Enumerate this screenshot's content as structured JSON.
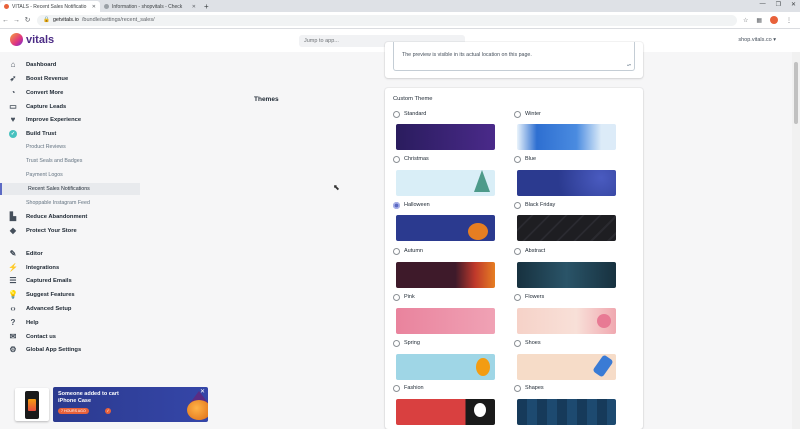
{
  "browser": {
    "tabs": [
      {
        "label": "VITALS - Recent Sales Notificatio",
        "active": true
      },
      {
        "label": "Information - shopvitals - Check",
        "active": false
      }
    ],
    "new_tab": "+",
    "url_host": "getvitals.io",
    "url_path": "/bundle/settings/recent_sales/"
  },
  "header": {
    "brand": "vitals",
    "jump_placeholder": "Jump to app...",
    "shop": "shop.vitals.co"
  },
  "sidebar": {
    "items": [
      {
        "label": "Dashboard",
        "icon": "home-icon"
      },
      {
        "label": "Boost Revenue",
        "icon": "rocket-icon"
      },
      {
        "label": "Convert More",
        "icon": "chat-icon"
      },
      {
        "label": "Capture Leads",
        "icon": "inbox-icon"
      },
      {
        "label": "Improve Experience",
        "icon": "heart-icon"
      },
      {
        "label": "Build Trust",
        "icon": "check-circle-icon"
      },
      {
        "label": "Reduce Abandonment",
        "icon": "cart-icon"
      },
      {
        "label": "Protect Your Store",
        "icon": "shield-icon"
      },
      {
        "label": "Editor",
        "icon": "pencil-icon"
      },
      {
        "label": "Integrations",
        "icon": "plug-icon"
      },
      {
        "label": "Captured Emails",
        "icon": "list-icon"
      },
      {
        "label": "Suggest Features",
        "icon": "bulb-icon"
      },
      {
        "label": "Advanced Setup",
        "icon": "code-icon"
      },
      {
        "label": "Help",
        "icon": "question-icon"
      },
      {
        "label": "Contact us",
        "icon": "mail-icon"
      },
      {
        "label": "Global App Settings",
        "icon": "gear-icon"
      }
    ],
    "sub_items": [
      {
        "label": "Product Reviews",
        "active": false
      },
      {
        "label": "Trust Seals and Badges",
        "active": false
      },
      {
        "label": "Payment Logos",
        "active": false
      },
      {
        "label": "Recent Sales Notifications",
        "active": true
      },
      {
        "label": "Shoppable Instagram Feed",
        "active": false
      }
    ]
  },
  "main": {
    "preview_text": "The preview is visible in its actual location on this page.",
    "section_title": "Themes",
    "custom_theme_label": "Custom Theme",
    "themes": [
      {
        "name": "Standard",
        "selected": false,
        "color": "#3a2a7a"
      },
      {
        "name": "Winter",
        "selected": false,
        "color": "#2e6fd1"
      },
      {
        "name": "Christmas",
        "selected": false,
        "color": "#d9eef7"
      },
      {
        "name": "Blue",
        "selected": false,
        "color": "#2b3a8f"
      },
      {
        "name": "Halloween",
        "selected": true,
        "color": "#2b3a8f"
      },
      {
        "name": "Black Friday",
        "selected": false,
        "color": "#1e1e22"
      },
      {
        "name": "Autumn",
        "selected": false,
        "color": "#4a1e2e"
      },
      {
        "name": "Abstract",
        "selected": false,
        "color": "#1d3a4d"
      },
      {
        "name": "Pink",
        "selected": false,
        "color": "#e9839d"
      },
      {
        "name": "Flowers",
        "selected": false,
        "color": "#f6d2c8"
      },
      {
        "name": "Spring",
        "selected": false,
        "color": "#9fd6e6"
      },
      {
        "name": "Shoes",
        "selected": false,
        "color": "#f6dcc8"
      },
      {
        "name": "Fashion",
        "selected": false,
        "color": "#d94040"
      },
      {
        "name": "Shapes",
        "selected": false,
        "color": "#163a5a"
      }
    ]
  },
  "popup": {
    "line1": "Someone added to cart",
    "line2": "iPhone Case",
    "time": "7 HOURS AGO",
    "verified": "✓",
    "close": "✕"
  },
  "colors": {
    "accent": "#5c6ac4",
    "brand": "#4b2b85"
  }
}
